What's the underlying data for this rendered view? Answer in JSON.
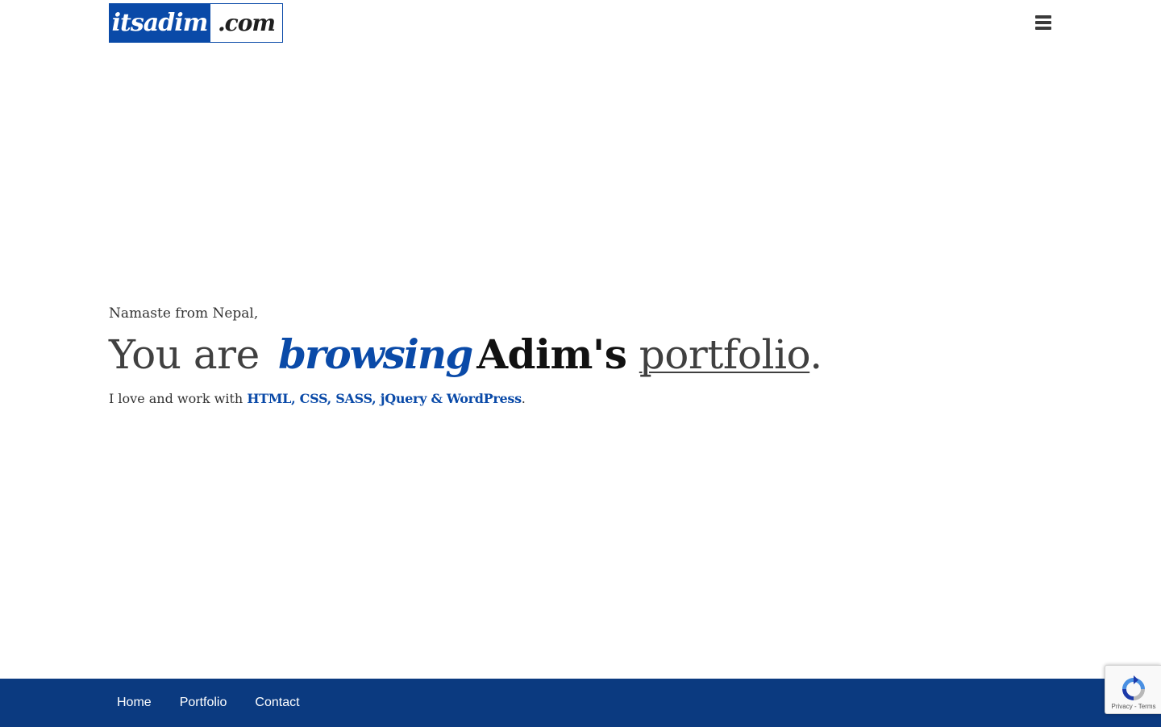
{
  "header": {
    "logo_main": "itsadim",
    "logo_tld": ".com",
    "menu_icon": "hamburger-menu-icon"
  },
  "hero": {
    "greeting": "Namaste from Nepal,",
    "headline_prefix": "You are",
    "headline_italic": "browsing",
    "headline_name": "Adim's",
    "headline_link": "portfolio",
    "headline_suffix": ".",
    "skills_prefix": "I love and work with",
    "skills": "HTML, CSS, SASS, jQuery & WordPress",
    "skills_suffix": "."
  },
  "footer": {
    "nav": [
      {
        "label": "Home"
      },
      {
        "label": "Portfolio"
      },
      {
        "label": "Contact"
      }
    ]
  },
  "recaptcha": {
    "privacy": "Privacy",
    "separator": " - ",
    "terms": "Terms"
  },
  "colors": {
    "brand_blue": "#0a4aa8",
    "footer_blue": "#0b3a80",
    "text": "#333333"
  }
}
